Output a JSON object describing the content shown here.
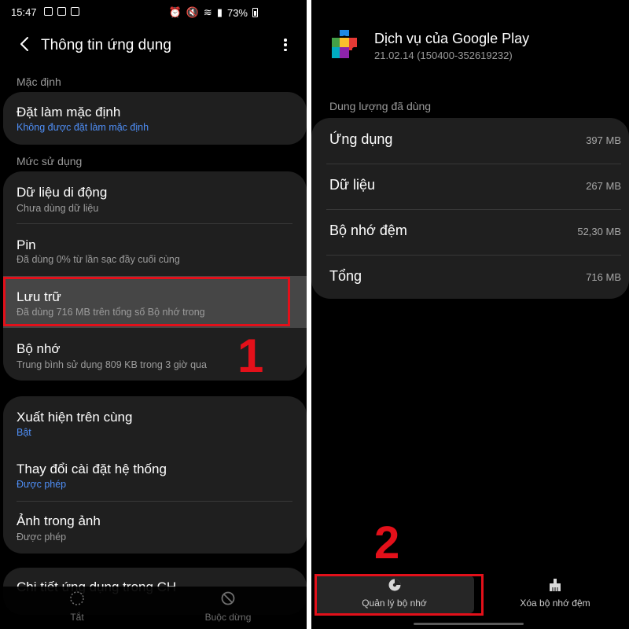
{
  "left": {
    "status": {
      "time": "15:47",
      "battery": "73%"
    },
    "header": {
      "title": "Thông tin ứng dụng"
    },
    "sections": {
      "default_label": "Mặc định",
      "usage_label": "Mức sử dụng"
    },
    "default_card": {
      "main": "Đặt làm mặc định",
      "sub": "Không được đặt làm mặc định"
    },
    "usage_items": [
      {
        "main": "Dữ liệu di động",
        "sub": "Chưa dùng dữ liệu"
      },
      {
        "main": "Pin",
        "sub": "Đã dùng 0% từ lần sạc đầy cuối cùng"
      },
      {
        "main": "Lưu trữ",
        "sub": "Đã dùng 716 MB trên tổng số Bộ nhớ trong"
      },
      {
        "main": "Bộ nhớ",
        "sub": "Trung bình sử dụng 809 KB trong 3 giờ qua"
      }
    ],
    "advanced_items": [
      {
        "main": "Xuất hiện trên cùng",
        "sub": "Bật"
      },
      {
        "main": "Thay đổi cài đặt hệ thống",
        "sub": "Được phép"
      },
      {
        "main": "Ảnh trong ảnh",
        "sub": "Được phép"
      }
    ],
    "partial_item": "Chi tiết ứng dụng trong CH",
    "annotation": "1",
    "bottom": {
      "disable": "Tắt",
      "force_stop": "Buộc dừng"
    }
  },
  "right": {
    "app": {
      "name": "Dịch vụ của Google Play",
      "version": "21.02.14 (150400-352619232)"
    },
    "section_label": "Dung lượng đã dùng",
    "storage_rows": [
      {
        "label": "Ứng dụng",
        "value": "397 MB"
      },
      {
        "label": "Dữ liệu",
        "value": "267 MB"
      },
      {
        "label": "Bộ nhớ đệm",
        "value": "52,30 MB"
      },
      {
        "label": "Tổng",
        "value": "716 MB"
      }
    ],
    "annotation": "2",
    "bottom": {
      "manage": "Quản lý bộ nhớ",
      "clear_cache": "Xóa bộ nhớ đệm"
    }
  },
  "colors": {
    "accent_blue": "#4f8ff7",
    "annotation_red": "#e3101a",
    "card_bg": "#1f1f1f",
    "highlight_bg": "#464646"
  }
}
